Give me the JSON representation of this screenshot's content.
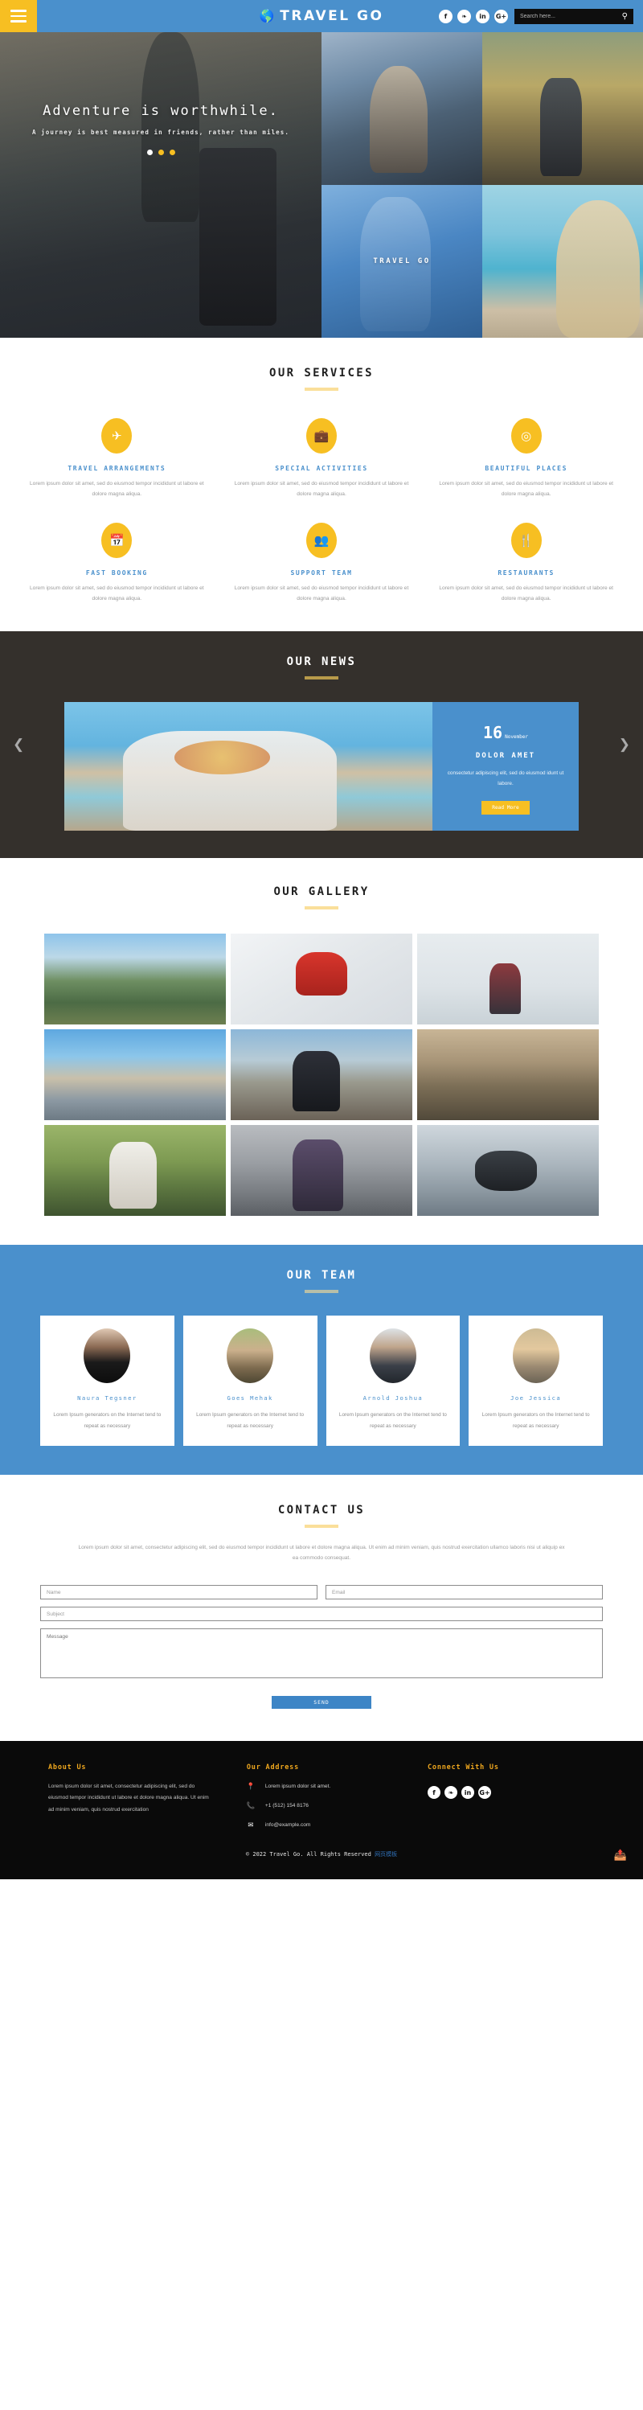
{
  "header": {
    "menu_icon": "hamburger-icon",
    "brand_mark": "globe-icon",
    "brand": "TRAVEL GO",
    "social": [
      {
        "name": "facebook",
        "glyph": "f"
      },
      {
        "name": "twitter",
        "glyph": "❧"
      },
      {
        "name": "linkedin",
        "glyph": "in"
      },
      {
        "name": "google-plus",
        "glyph": "G+"
      }
    ],
    "search_placeholder": "Search here...",
    "search_value": "",
    "search_icon": "search-icon"
  },
  "hero": {
    "title": "Adventure is worthwhile.",
    "subtitle": "A journey is best measured in friends, rather than miles.",
    "dots": [
      "1",
      "2",
      "3"
    ],
    "active_dot": 0,
    "tile_label": "TRAVEL GO"
  },
  "services": {
    "title": "OUR SERVICES",
    "items": [
      {
        "icon": "airplane-icon",
        "glyph": "✈",
        "name": "TRAVEL ARRANGEMENTS",
        "desc": "Lorem ipsum dolor sit amet, sed do eiusmod tempor incididunt ut labore et dolore magna aliqua."
      },
      {
        "icon": "suitcase-icon",
        "glyph": "ὋC",
        "name": "SPECIAL ACTIVITIES",
        "desc": "Lorem ipsum dolor sit amet, sed do eiusmod tempor incididunt ut labore et dolore magna aliqua."
      },
      {
        "icon": "map-pin-icon",
        "glyph": "♈",
        "name": "BEAUTIFUL PLACES",
        "desc": "Lorem ipsum dolor sit amet, sed do eiusmod tempor incididunt ut labore et dolore magna aliqua."
      },
      {
        "icon": "calendar-icon",
        "glyph": "Ὄ5",
        "name": "FAST BOOKING",
        "desc": "Lorem ipsum dolor sit amet, sed do eiusmod tempor incididunt ut labore et dolore magna aliqua."
      },
      {
        "icon": "people-icon",
        "glyph": "὆5",
        "name": "SUPPORT TEAM",
        "desc": "Lorem ipsum dolor sit amet, sed do eiusmod tempor incididunt ut labore et dolore magna aliqua."
      },
      {
        "icon": "cutlery-icon",
        "glyph": "ἷ4",
        "name": "RESTAURANTS",
        "desc": "Lorem ipsum dolor sit amet, sed do eiusmod tempor incididunt ut labore et dolore magna aliqua."
      }
    ]
  },
  "news": {
    "title": "OUR NEWS",
    "prev_icon": "chevron-left-icon",
    "next_icon": "chevron-right-icon",
    "card": {
      "day": "16",
      "month": "November",
      "heading": "DOLOR AMET",
      "text": "consectetur adipiscing elit, sed do eiusmod idunt ut labore.",
      "button": "Read More"
    }
  },
  "gallery": {
    "title": "OUR GALLERY",
    "items": [
      {
        "name": "mountain-hiker-photo"
      },
      {
        "name": "skier-photo"
      },
      {
        "name": "man-by-lake-photo"
      },
      {
        "name": "city-bridge-photo"
      },
      {
        "name": "woman-at-harbor-photo"
      },
      {
        "name": "woman-driving-photo"
      },
      {
        "name": "woman-in-field-photo"
      },
      {
        "name": "backpacker-railway-photo"
      },
      {
        "name": "skydiver-photo"
      }
    ]
  },
  "team": {
    "title": "OUR TEAM",
    "members": [
      {
        "name": "Naura Tegsner",
        "desc": "Lorem Ipsum generators on the Internet tend to repeat as necessary"
      },
      {
        "name": "Goes Mehak",
        "desc": "Lorem Ipsum generators on the Internet tend to repeat as necessary"
      },
      {
        "name": "Arnold Joshua",
        "desc": "Lorem Ipsum generators on the Internet tend to repeat as necessary"
      },
      {
        "name": "Joe Jessica",
        "desc": "Lorem Ipsum generators on the Internet tend to repeat as necessary"
      }
    ]
  },
  "contact": {
    "title": "CONTACT US",
    "intro": "Lorem ipsum dolor sit amet, consectetur adipiscing elit, sed do eiusmod tempor incididunt ut labore et dolore magna aliqua. Ut enim ad minim veniam, quis nostrud exercitation ullamco laboris nisi ut aliquip ex ea commodo consequat.",
    "name_placeholder": "Name",
    "email_placeholder": "Email",
    "subject_placeholder": "Subject",
    "message_placeholder": "Message",
    "send_label": "SEND"
  },
  "footer": {
    "about_title": "About Us",
    "about_text": "Lorem ipsum dolor sit amet, consectetur adipiscing elit, sed do eiusmod tempor incididunt ut labore et dolore magna aliqua. Ut enim ad minim veniam, quis nostrud exercitation",
    "address_title": "Our Address",
    "address_items": [
      {
        "icon": "location-pin-icon",
        "glyph": "▼",
        "text": "Lorem ipsum dolor sit amet."
      },
      {
        "icon": "phone-icon",
        "glyph": "☎",
        "text": "+1 (512) 154 8176"
      },
      {
        "icon": "envelope-icon",
        "glyph": "✉",
        "text": "info@example.com"
      }
    ],
    "connect_title": "Connect With Us",
    "social": [
      {
        "name": "facebook",
        "glyph": "f"
      },
      {
        "name": "twitter",
        "glyph": "❧"
      },
      {
        "name": "linkedin",
        "glyph": "in"
      },
      {
        "name": "google-plus",
        "glyph": "G+"
      }
    ],
    "copyright": "© 2022 Travel Go. All Rights Reserved ",
    "copyright_link": "网页模板",
    "share_icon": "share-icon"
  },
  "colors": {
    "brand_blue": "#4a90cc",
    "accent_yellow": "#f7bf22",
    "news_bg": "#34302c",
    "footer_bg": "#0a0a0a"
  }
}
